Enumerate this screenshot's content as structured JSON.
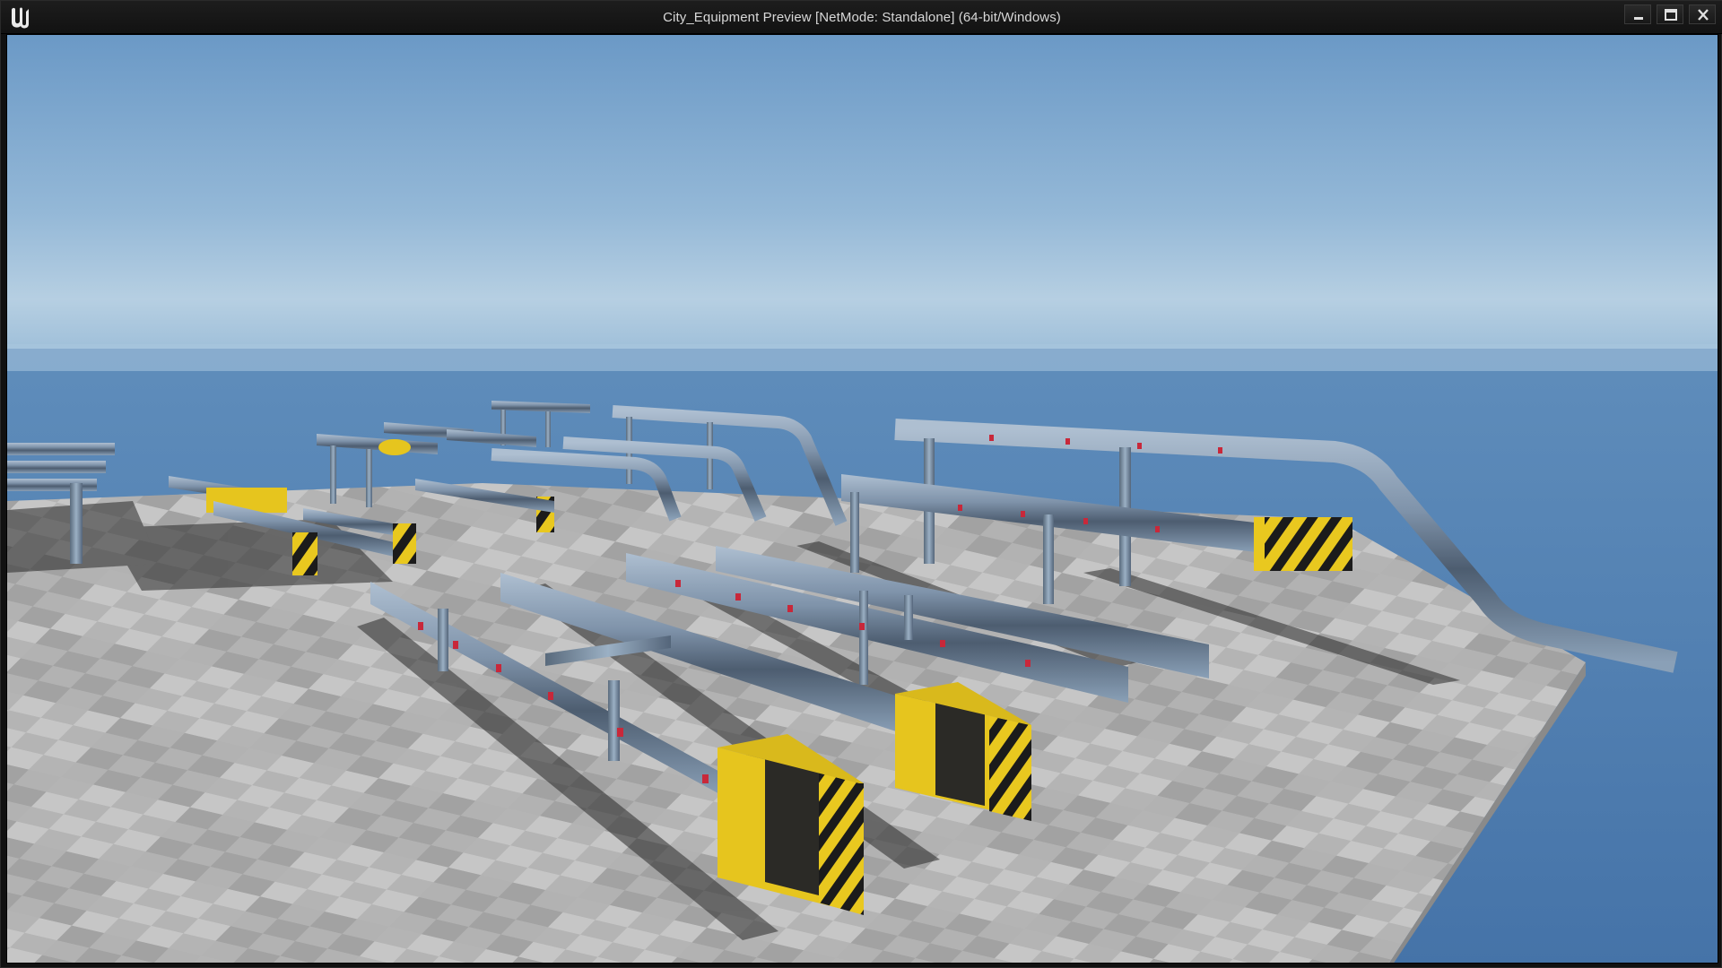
{
  "window": {
    "title": "City_Equipment Preview [NetMode: Standalone]  (64-bit/Windows)",
    "logo_icon": "unreal-engine-logo-icon",
    "controls": {
      "minimize_icon": "minimize-icon",
      "maximize_icon": "maximize-icon",
      "close_icon": "close-icon"
    }
  },
  "viewport": {
    "scene": "3d-guardrail-preview",
    "colors": {
      "sky_top": "#6e9cc8",
      "sky_haze": "#a9c8e0",
      "ocean": "#4f7fb2",
      "floor_light": "#c9c9c9",
      "floor_dark": "#a8a8a8",
      "rail_steel": "#7f95ad",
      "hazard_yellow": "#e6c51e",
      "reflector_red": "#c8283a"
    }
  }
}
